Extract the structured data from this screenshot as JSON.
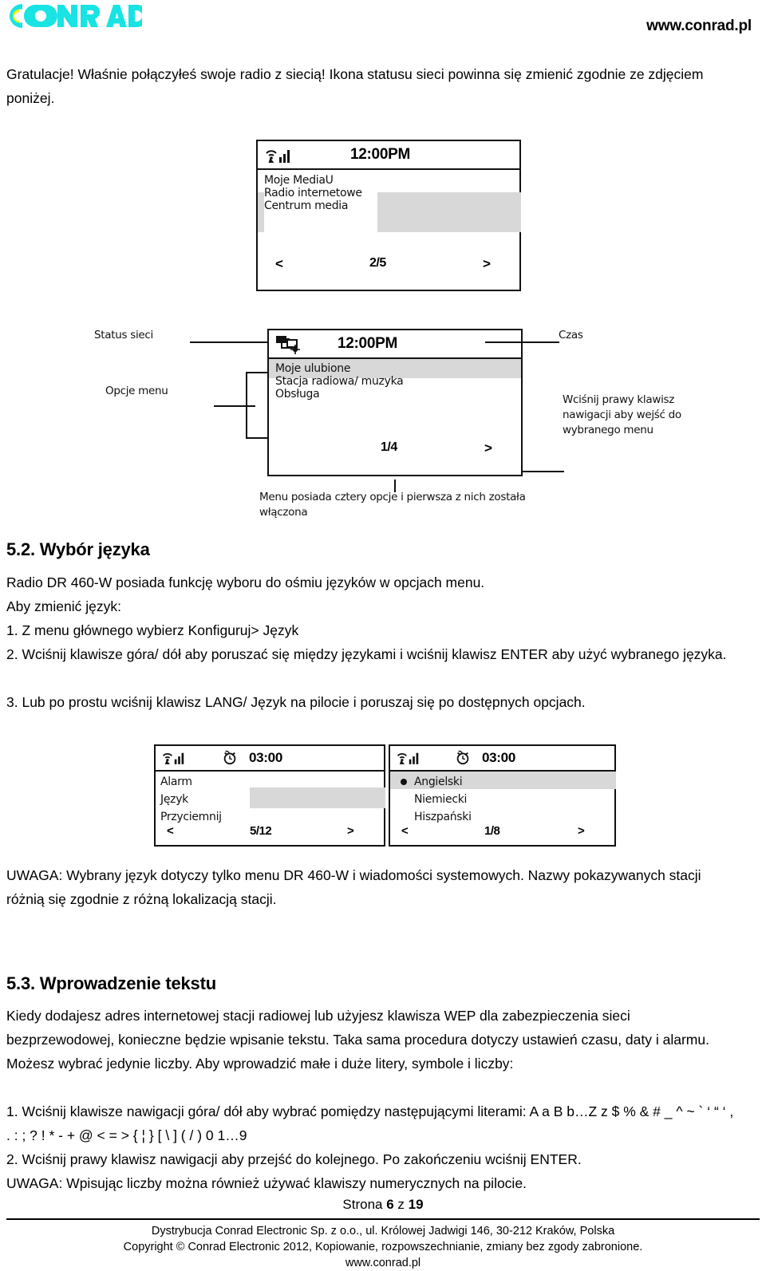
{
  "header": {
    "logo_text": "CONRAD",
    "logo_colors": {
      "primary": "#19E3E3",
      "accent": "#F2F200"
    },
    "site_url": "www.conrad.pl"
  },
  "intro": {
    "paragraph": "Gratulacje! Właśnie połączyłeś swoje radio z siecią! Ikona statusu sieci powinna się zmienić zgodnie ze zdjęciem poniżej."
  },
  "figure1": {
    "status_time": "12:00PM",
    "wifi_icon": "wifi-signal-icon",
    "menu_items": [
      "Moje MediaU",
      "Radio internetowe",
      "Centrum media"
    ],
    "pager": "2/5",
    "prev_arrow": "<",
    "next_arrow": ">"
  },
  "figure2": {
    "status_time": "12:00PM",
    "network_icon": "network-connected-icon",
    "menu_items": [
      "Moje ulubione",
      "Stacja radiowa/ muzyka",
      "Obsługa"
    ],
    "pager": "1/4",
    "next_arrow": ">",
    "labels": {
      "network_status": "Status sieci",
      "menu_options": "Opcje menu",
      "time": "Czas",
      "right_key_hint": "Wciśnij prawy klawisz\nnawigacji aby wejść do\nwybranego menu",
      "caption": "Menu posiada cztery opcje i pierwsza z nich została\nwłączona"
    }
  },
  "section_5_2": {
    "title": "5.2. Wybór języka",
    "lines": [
      "Radio DR 460-W posiada funkcję wyboru do ośmiu języków  w opcjach menu.",
      "Aby zmienić język:",
      "1. Z menu głównego wybierz Konfiguruj> Język",
      "2. Wciśnij klawisze góra/ dół aby poruszać się między językami i wciśnij klawisz ENTER aby użyć wybranego języka.",
      "3. Lub po prostu wciśnij klawisz LANG/ Język na pilocie i poruszaj się po dostępnych opcjach."
    ],
    "note": "UWAGA: Wybrany język dotyczy tylko menu DR 460-W i wiadomości systemowych. Nazwy pokazywanych stacji różnią się zgodnie z różną lokalizacją stacji."
  },
  "figure3_left": {
    "wifi_icon": "wifi-signal-icon",
    "alarm_icon": "alarm-clock-icon",
    "status_time": "03:00",
    "menu_items": [
      "Alarm",
      "Język",
      "Przyciemnij"
    ],
    "pager": "5/12",
    "prev_arrow": "<",
    "next_arrow": ">"
  },
  "figure3_right": {
    "wifi_icon": "wifi-signal-icon",
    "alarm_icon": "alarm-clock-icon",
    "status_time": "03:00",
    "menu_items": [
      "Angielski",
      "Niemiecki",
      "Hiszpański"
    ],
    "selected_index": 0,
    "radio_icon": "radio-selected-icon",
    "pager": "1/8",
    "prev_arrow": "<",
    "next_arrow": ">"
  },
  "section_5_3": {
    "title": "5.3. Wprowadzenie tekstu",
    "lines": [
      "Kiedy dodajesz adres internetowej stacji radiowej lub użyjesz klawisza WEP dla zabezpieczenia sieci bezprzewodowej, konieczne będzie wpisanie tekstu. Taka sama procedura dotyczy ustawień czasu, daty i alarmu. Możesz wybrać jedynie liczby. Aby wprowadzić małe i duże litery, symbole i liczby:",
      "1. Wciśnij klawisze nawigacji góra/ dół aby wybrać pomiędzy następującymi literami: A a B b…Z z $ % & # _ ^ ~ ` ‘ “ ‘ , . : ; ? ! * - + @ < = > { ¦ } [ \\ ] ( / ) 0 1…9",
      "2. Wciśnij prawy klawisz nawigacji aby przejść do kolejnego. Po zakończeniu wciśnij ENTER.",
      "UWAGA: Wpisując liczby można również używać klawiszy numerycznych na pilocie."
    ]
  },
  "footer": {
    "page_label_prefix": "Strona ",
    "page_current": "6",
    "page_of": " z ",
    "page_total": "19",
    "line1": "Dystrybucja Conrad Electronic Sp. z o.o., ul. Królowej Jadwigi 146, 30-212 Kraków, Polska",
    "line2": "Copyright © Conrad Electronic 2012, Kopiowanie, rozpowszechnianie, zmiany bez zgody zabronione.",
    "line3": "www.conrad.pl"
  }
}
